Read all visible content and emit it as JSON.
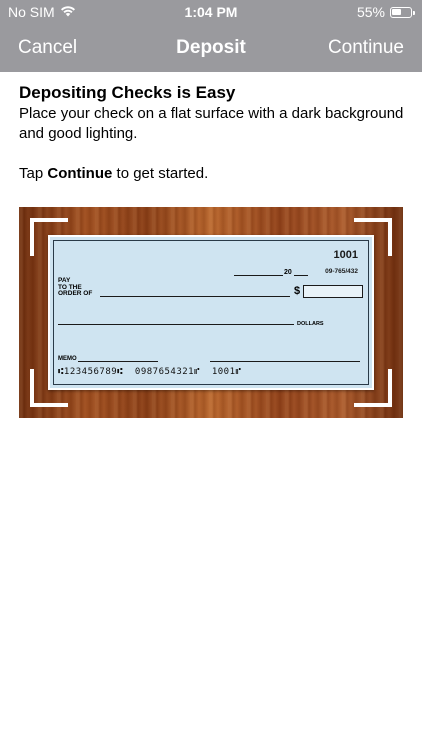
{
  "status": {
    "carrier": "No SIM",
    "time": "1:04 PM",
    "battery_percent": "55%",
    "battery_level": 0.55
  },
  "nav": {
    "cancel_label": "Cancel",
    "title": "Deposit",
    "continue_label": "Continue"
  },
  "content": {
    "heading": "Depositing Checks is Easy",
    "description": "Place your check on a flat surface with a dark background and good lighting.",
    "tap_prefix": "Tap ",
    "tap_bold": "Continue",
    "tap_suffix": " to get started."
  },
  "check": {
    "number": "1001",
    "routing_fraction": "09-765/432",
    "year_prefix": "20",
    "pay_label_1": "PAY",
    "pay_label_2": "TO THE",
    "pay_label_3": "ORDER OF",
    "dollar_sign": "$",
    "dollars_label": "DOLLARS",
    "memo_label": "MEMO",
    "micr_line": "⑆123456789⑆  0987654321⑈  1001⑈"
  },
  "colors": {
    "nav_bg": "#9a9a9e",
    "check_bg": "#cfe4f1",
    "wood": "#a04e1f"
  }
}
